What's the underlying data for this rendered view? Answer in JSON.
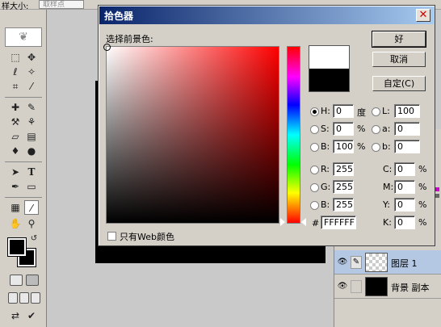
{
  "options_bar": {
    "label": "样大小:",
    "sample_value": "取样点"
  },
  "dialog": {
    "title": "拾色器",
    "pick_label": "选择前景色:",
    "buttons": {
      "ok": "好",
      "cancel": "取消",
      "custom": "自定(C)"
    },
    "hsb": [
      {
        "label": "H:",
        "value": "0",
        "unit": "度",
        "selected": true
      },
      {
        "label": "S:",
        "value": "0",
        "unit": "%",
        "selected": false
      },
      {
        "label": "B:",
        "value": "100",
        "unit": "%",
        "selected": false
      }
    ],
    "lab": [
      {
        "label": "L:",
        "value": "100"
      },
      {
        "label": "a:",
        "value": "0"
      },
      {
        "label": "b:",
        "value": "0"
      }
    ],
    "rgb": [
      {
        "label": "R:",
        "value": "255"
      },
      {
        "label": "G:",
        "value": "255"
      },
      {
        "label": "B:",
        "value": "255"
      }
    ],
    "cmyk": [
      {
        "label": "C:",
        "value": "0",
        "unit": "%"
      },
      {
        "label": "M:",
        "value": "0",
        "unit": "%"
      },
      {
        "label": "Y:",
        "value": "0",
        "unit": "%"
      },
      {
        "label": "K:",
        "value": "0",
        "unit": "%"
      }
    ],
    "hex_label": "#",
    "hex_value": "FFFFFF",
    "web_only_label": "只有Web颜色",
    "new_color": "#FFFFFF",
    "current_color": "#000000"
  },
  "layers": [
    {
      "name": "图层 1",
      "active": true
    },
    {
      "name": "背景 副本",
      "active": false
    }
  ],
  "colors": {
    "title_bar_start": "#0a246a",
    "title_bar_end": "#a6caf0",
    "dialog_bg": "#d4d0c8",
    "active_layer": "#b4c8e4"
  }
}
